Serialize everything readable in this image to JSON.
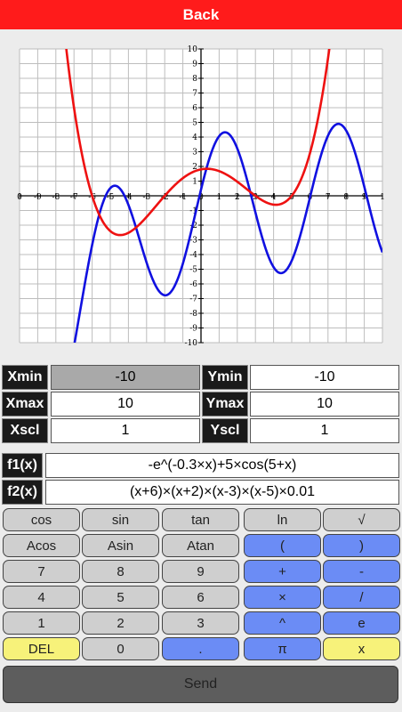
{
  "header": {
    "back_label": "Back"
  },
  "chart_data": {
    "type": "line",
    "xlim": [
      -10,
      10
    ],
    "ylim": [
      -10,
      10
    ],
    "xtick_labels": [
      "0",
      "-9",
      "-8",
      "-7",
      "-6",
      "-5",
      "-4",
      "-3",
      "-2",
      "-1",
      "0",
      "1",
      "2",
      "3",
      "4",
      "5",
      "6",
      "7",
      "8",
      "9",
      "1"
    ],
    "ytick_labels": [
      "10",
      "9",
      "8",
      "7",
      "6",
      "5",
      "4",
      "3",
      "2",
      "1",
      "-1",
      "-2",
      "-3",
      "-4",
      "-5",
      "-6",
      "-7",
      "-8",
      "-9",
      "-10"
    ],
    "grid": true,
    "series": [
      {
        "color": "#1010e0",
        "expr": "-e^(-0.3x)+5cos(5+x)"
      },
      {
        "color": "#ee1111",
        "expr": "(x+6)(x+2)(x-3)(x-5)*0.01"
      }
    ]
  },
  "range": {
    "xmin_label": "Xmin",
    "xmin_value": "-10",
    "ymin_label": "Ymin",
    "ymin_value": "-10",
    "xmax_label": "Xmax",
    "xmax_value": "10",
    "ymax_label": "Ymax",
    "ymax_value": "10",
    "xscl_label": "Xscl",
    "xscl_value": "1",
    "yscl_label": "Yscl",
    "yscl_value": "1"
  },
  "functions": {
    "f1_label": "f1(x)",
    "f1_value": "-e^(-0.3×x)+5×cos(5+x)",
    "f2_label": "f2(x)",
    "f2_value": "(x+6)×(x+2)×(x-3)×(x-5)×0.01"
  },
  "keypad": [
    [
      "cos",
      "sin",
      "tan",
      "ln",
      "√"
    ],
    [
      "Acos",
      "Asin",
      "Atan",
      "(",
      ")"
    ],
    [
      "7",
      "8",
      "9",
      "+",
      "-"
    ],
    [
      "4",
      "5",
      "6",
      "×",
      "/"
    ],
    [
      "1",
      "2",
      "3",
      "^",
      "e"
    ],
    [
      "DEL",
      "0",
      ".",
      "π",
      "x"
    ]
  ],
  "colors": {
    "gray_key": "#cfcfcf",
    "blue_key": "#6b8cf5",
    "yellow_key": "#f7f27a",
    "header": "#ff1b1b"
  },
  "send_label": "Send"
}
